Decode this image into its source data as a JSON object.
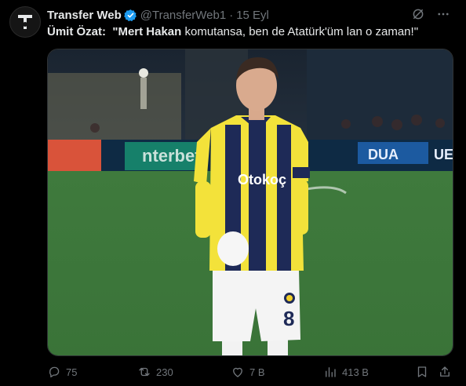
{
  "tweet": {
    "author_name": "Transfer Web",
    "author_handle": "@TransferWeb1",
    "separator": "·",
    "date": "15 Eyl",
    "text": {
      "speaker": "Ümit Özat:",
      "quote_bold": "\"Mert Hakan",
      "quote_rest": " komutansa, ben de Atatürk'üm lan o zaman!\""
    },
    "media": {
      "kind": "photo",
      "sponsor_text": "Otokoç",
      "jersey_number": "8",
      "board_text_1": "nterbet",
      "board_text_2": "DUA",
      "board_text_3": "UE"
    },
    "stats": {
      "replies": "75",
      "reposts": "230",
      "likes": "7 B",
      "views": "413 B"
    }
  },
  "colors": {
    "background": "#000000",
    "text": "#e7e9ea",
    "muted": "#71767b",
    "verified": "#1d9bf0"
  },
  "icons": {
    "avatar": "transfer-web-logo",
    "verified": "verified-badge-icon",
    "grok": "grok-icon",
    "more": "more-icon",
    "reply": "reply-icon",
    "repost": "repost-icon",
    "like": "heart-icon",
    "views": "views-icon",
    "bookmark": "bookmark-icon",
    "share": "share-icon"
  }
}
